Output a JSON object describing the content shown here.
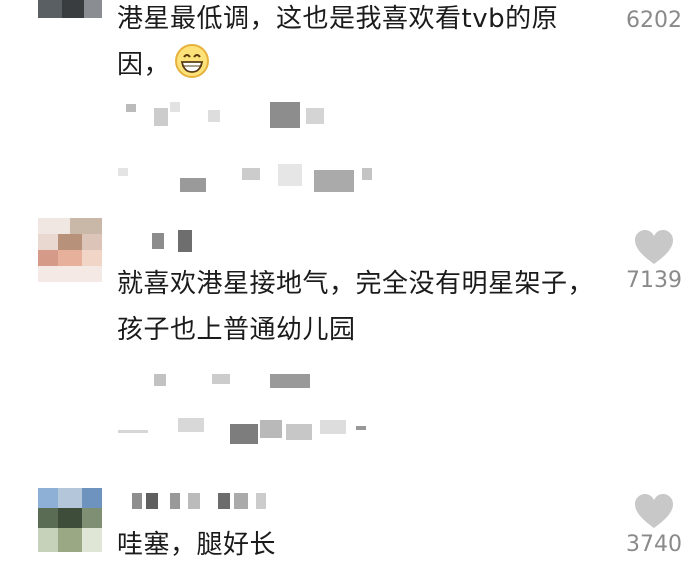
{
  "comments": [
    {
      "text": "港星最低调，这也是我喜欢看tvb的原因，",
      "emoji": "grinning-face-emoji",
      "like_count": "6202"
    },
    {
      "text": "就喜欢港星接地气，完全没有明星架子，孩子也上普通幼儿园",
      "like_count": "7139"
    },
    {
      "text": "哇塞，腿好长",
      "like_count": "3740"
    }
  ],
  "icons": {
    "like": "heart-icon"
  },
  "colors": {
    "heart": "#c8c8c8",
    "count": "#8a8a8a",
    "text": "#1b1b1b"
  }
}
